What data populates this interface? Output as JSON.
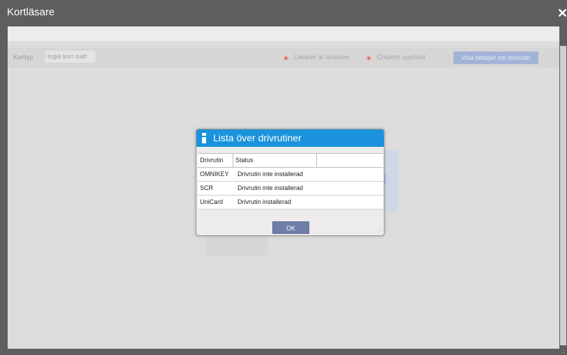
{
  "window": {
    "title": "Kortläsare",
    "close_glyph": "✕"
  },
  "toolbar": {
    "card_type_label": "Korttyp",
    "card_type_value": "Inget kort isatt",
    "reader_status": "Läsaren är ansluten",
    "chip_status": "Chipkort upptäckt",
    "details_button": "Visa detaljer om drivrutin",
    "status_dot_color": "#d35c5c"
  },
  "background": {
    "card_text": "rd"
  },
  "dialog": {
    "title": "Lista över drivrutiner",
    "icon": "info-icon",
    "header_color": "#1a93dc",
    "columns": [
      "Drivrutin",
      "Status"
    ],
    "rows": [
      {
        "driver": "OMNIKEY",
        "status": "Drivrutin inte installerad"
      },
      {
        "driver": "SCR",
        "status": "Drivrutin inte installerad"
      },
      {
        "driver": "UniCard",
        "status": "Drivrutin installerad"
      }
    ],
    "ok_button": "OK"
  }
}
